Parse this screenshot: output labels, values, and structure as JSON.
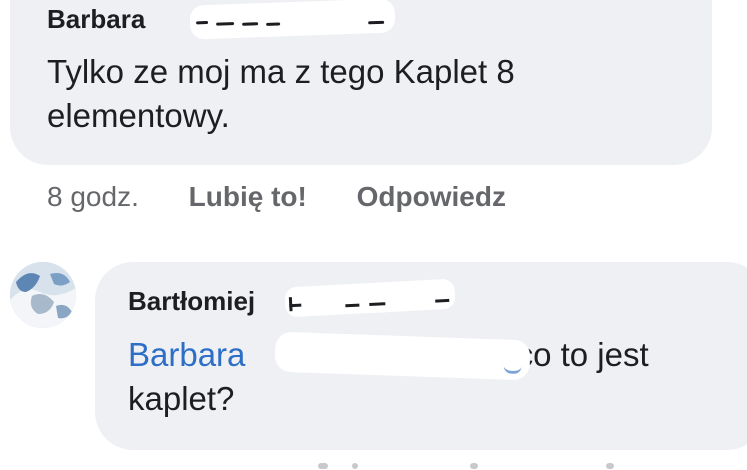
{
  "comment1": {
    "author_visible": "Barbara",
    "body": "Tylko ze moj ma z tego  Kaplet 8 elementowy.",
    "time": "8 godz.",
    "like_label": "Lubię to!",
    "reply_label": "Odpowiedz"
  },
  "comment2": {
    "author_visible": "Bartłomiej",
    "mention": "Barbara",
    "body_rest": " co to jest kaplet?",
    "avatar_icon": "profile-photo"
  },
  "colors": {
    "bubble_bg": "#eff0f3",
    "text": "#1c1e21",
    "secondary_text": "#65676b",
    "mention": "#2d6ec6"
  }
}
